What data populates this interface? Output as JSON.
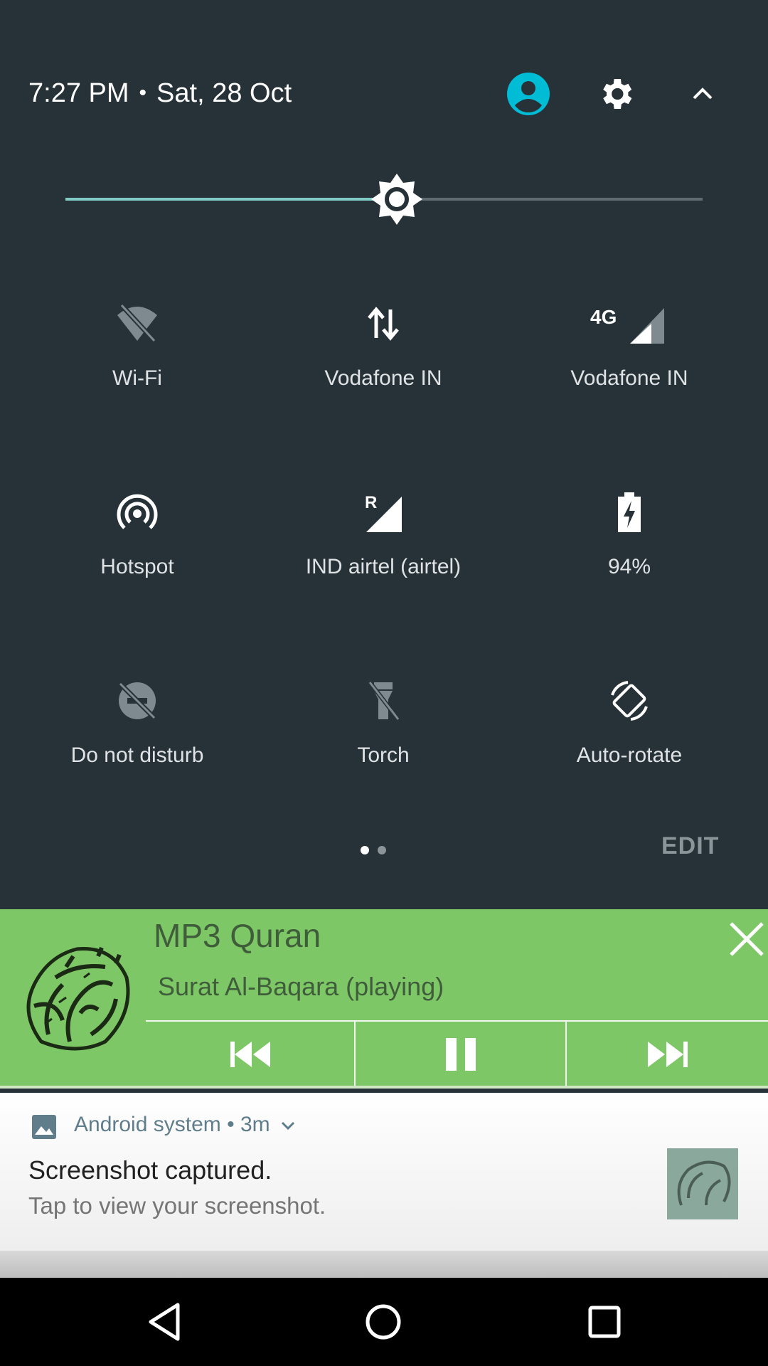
{
  "header": {
    "time": "7:27 PM",
    "separator": "•",
    "date": "Sat, 28 Oct"
  },
  "brightness": {
    "level": 0.52
  },
  "tiles": [
    {
      "label": "Wi-Fi",
      "icon": "wifi-off-icon",
      "active": false
    },
    {
      "label": "Vodafone IN",
      "icon": "data-transfer-icon",
      "active": true
    },
    {
      "label": "Vodafone IN",
      "icon": "signal-4g-icon",
      "badge": "4G",
      "active": true
    },
    {
      "label": "Hotspot",
      "icon": "hotspot-icon",
      "active": true
    },
    {
      "label": "IND airtel (airtel)",
      "icon": "signal-roaming-icon",
      "badge": "R",
      "active": true
    },
    {
      "label": "94%",
      "icon": "battery-charging-icon",
      "active": true
    },
    {
      "label": "Do not disturb",
      "icon": "dnd-off-icon",
      "active": false
    },
    {
      "label": "Torch",
      "icon": "torch-off-icon",
      "active": false
    },
    {
      "label": "Auto-rotate",
      "icon": "auto-rotate-icon",
      "active": true
    }
  ],
  "pager": {
    "current": 1,
    "total": 2
  },
  "edit_label": "EDIT",
  "media": {
    "title": "MP3 Quran",
    "subtitle": "Surat Al-Baqara (playing)",
    "controls": [
      "previous-icon",
      "pause-icon",
      "next-icon"
    ]
  },
  "notification": {
    "app": "Android system",
    "dot": "•",
    "age": "3m",
    "title": "Screenshot captured.",
    "text": "Tap to view your screenshot."
  },
  "colors": {
    "shade_bg": "#263238",
    "accent": "#80cbc4",
    "user_icon": "#00bcd4",
    "media_bg": "#7ec766"
  }
}
